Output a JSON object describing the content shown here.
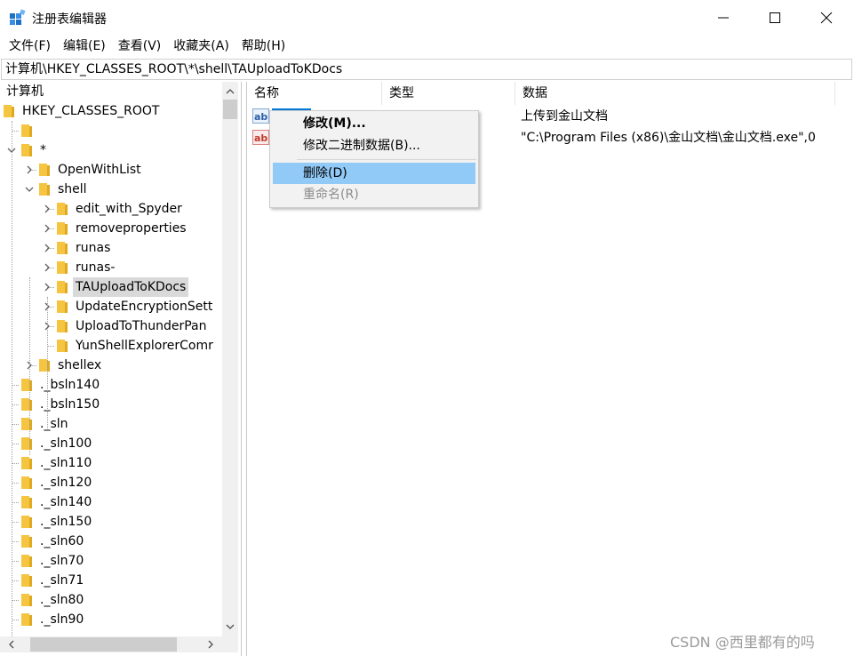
{
  "window": {
    "title": "注册表编辑器"
  },
  "menu": [
    "文件(F)",
    "编辑(E)",
    "查看(V)",
    "收藏夹(A)",
    "帮助(H)"
  ],
  "address": "计算机\\HKEY_CLASSES_ROOT\\*\\shell\\TAUploadToKDocs",
  "tree": {
    "root_label": "计算机",
    "items": [
      {
        "label": "HKEY_CLASSES_ROOT",
        "depth": 0,
        "expanded": true
      },
      {
        "label": "",
        "depth": 1
      },
      {
        "label": "*",
        "depth": 1,
        "expanded": true
      },
      {
        "label": "OpenWithList",
        "depth": 2
      },
      {
        "label": "shell",
        "depth": 2,
        "expanded": true
      },
      {
        "label": "edit_with_Spyder",
        "depth": 3
      },
      {
        "label": "removeproperties",
        "depth": 3
      },
      {
        "label": "runas",
        "depth": 3
      },
      {
        "label": "runas-",
        "depth": 3
      },
      {
        "label": "TAUploadToKDocs",
        "depth": 3,
        "selected": true
      },
      {
        "label": "UpdateEncryptionSett",
        "depth": 3
      },
      {
        "label": "UploadToThunderPan",
        "depth": 3
      },
      {
        "label": "YunShellExplorerComr",
        "depth": 3,
        "leaf": true
      },
      {
        "label": "shellex",
        "depth": 2
      },
      {
        "label": "._bsln140",
        "depth": 1
      },
      {
        "label": "._bsln150",
        "depth": 1
      },
      {
        "label": "._sln",
        "depth": 1
      },
      {
        "label": "._sln100",
        "depth": 1
      },
      {
        "label": "._sln110",
        "depth": 1
      },
      {
        "label": "._sln120",
        "depth": 1
      },
      {
        "label": "._sln140",
        "depth": 1
      },
      {
        "label": "._sln150",
        "depth": 1
      },
      {
        "label": "._sln60",
        "depth": 1
      },
      {
        "label": "._sln70",
        "depth": 1
      },
      {
        "label": "._sln71",
        "depth": 1
      },
      {
        "label": "._sln80",
        "depth": 1
      },
      {
        "label": "._sln90",
        "depth": 1
      }
    ]
  },
  "list": {
    "columns": [
      "名称",
      "类型",
      "数据"
    ],
    "rows": [
      {
        "data": "上传到金山文档"
      },
      {
        "data": "\"C:\\Program Files (x86)\\金山文档\\金山文档.exe\",0"
      }
    ]
  },
  "context_menu": {
    "modify": "修改(M)...",
    "modify_binary": "修改二进制数据(B)...",
    "delete": "删除(D)",
    "rename": "重命名(R)"
  },
  "watermark": "CSDN @西里都有的吗",
  "colors": {
    "selection": "#0078d7",
    "menu_highlight": "#91c9f7",
    "folder": "#f5c542"
  }
}
